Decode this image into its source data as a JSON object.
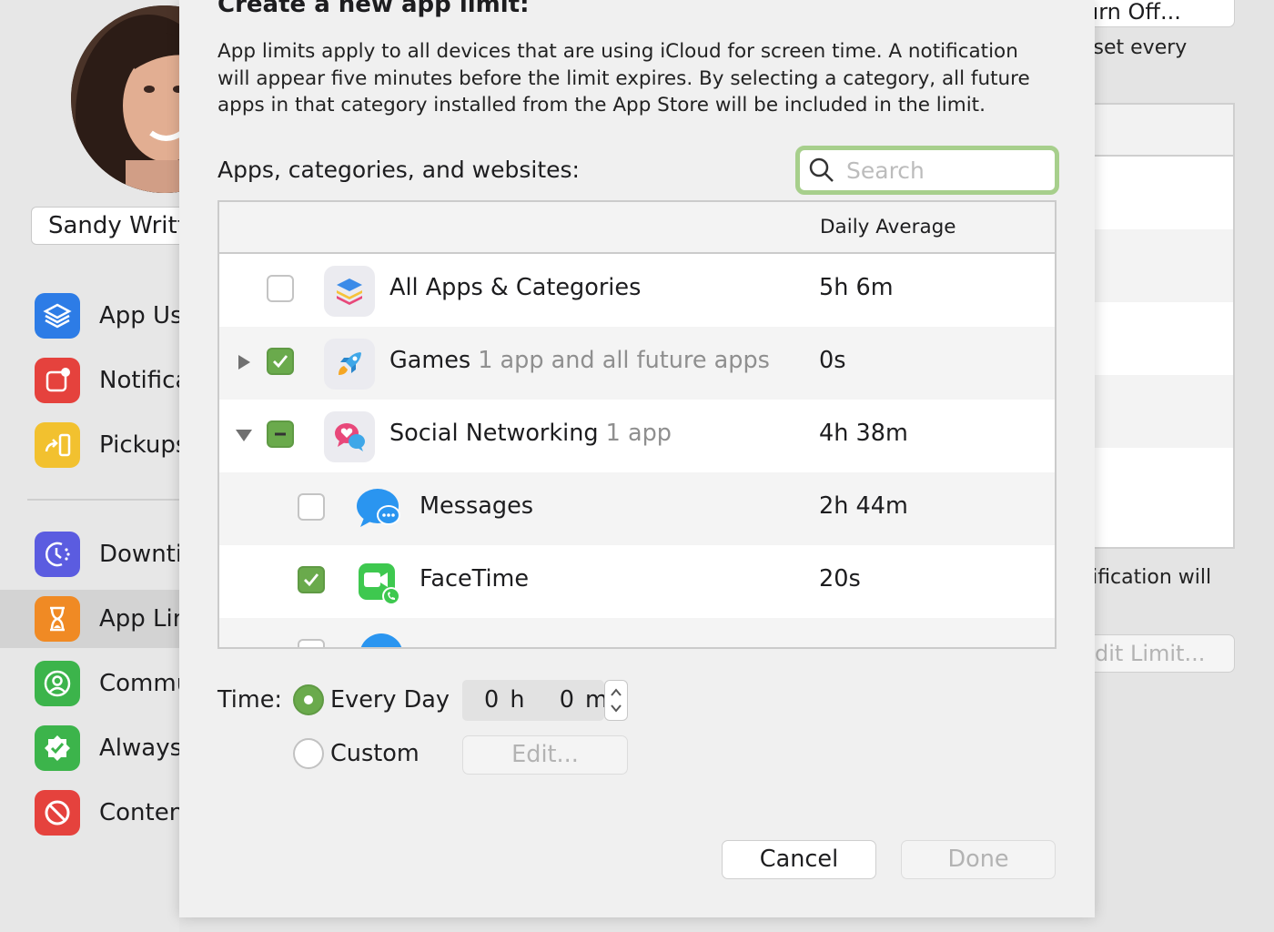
{
  "user": {
    "name": "Sandy Writt"
  },
  "sidebar": {
    "items": [
      {
        "label": "App Us",
        "icon": "layers-icon",
        "color": "#2d7ce6"
      },
      {
        "label": "Notifica",
        "icon": "notification-icon",
        "color": "#e5423d"
      },
      {
        "label": "Pickups",
        "icon": "pickup-icon",
        "color": "#f2c12f"
      },
      {
        "label": "Downti",
        "icon": "downtime-icon",
        "color": "#5b5ce0"
      },
      {
        "label": "App Lin",
        "icon": "hourglass-icon",
        "color": "#f08a24"
      },
      {
        "label": "Commu",
        "icon": "contact-icon",
        "color": "#3cb44b"
      },
      {
        "label": "Always",
        "icon": "checkmark-badge-icon",
        "color": "#3cb44b"
      },
      {
        "label": "Conten",
        "icon": "prohibited-icon",
        "color": "#e5423d"
      }
    ]
  },
  "background": {
    "turn_off_label": "Turn Off...",
    "reset_text": "eset every",
    "notification_text": "otification will",
    "edit_limit_label": "dit Limit..."
  },
  "sheet": {
    "title": "Create a new app limit:",
    "description": "App limits apply to all devices that are using iCloud for screen time. A notification will appear five minutes before the limit expires. By selecting a category, all future apps in that category installed from the App Store will be included in the limit.",
    "list_label": "Apps, categories, and websites:",
    "search_placeholder": "Search",
    "column_header": "Daily Average",
    "rows": [
      {
        "name": "All Apps & Categories",
        "sub": "",
        "avg": "5h 6m",
        "checked": "off",
        "disclosure": "none",
        "icon": "all-apps-stack-icon"
      },
      {
        "name": "Games",
        "sub": "1 app and all future apps",
        "avg": "0s",
        "checked": "on",
        "disclosure": "collapsed",
        "icon": "rocket-icon"
      },
      {
        "name": "Social Networking",
        "sub": "1 app",
        "avg": "4h 38m",
        "checked": "mixed",
        "disclosure": "expanded",
        "icon": "social-heart-icon"
      },
      {
        "name": "Messages",
        "sub": "",
        "avg": "2h 44m",
        "checked": "off",
        "disclosure": "none",
        "icon": "messages-icon"
      },
      {
        "name": "FaceTime",
        "sub": "",
        "avg": "20s",
        "checked": "on",
        "disclosure": "none",
        "icon": "facetime-icon"
      }
    ],
    "time_label": "Time:",
    "every_day_label": "Every Day",
    "custom_label": "Custom",
    "hours_value": "0 h",
    "minutes_value": "0 m",
    "edit_label": "Edit...",
    "cancel_label": "Cancel",
    "done_label": "Done",
    "accent_color": "#6aaa4c",
    "search_focus_color": "#a7cf8c"
  }
}
